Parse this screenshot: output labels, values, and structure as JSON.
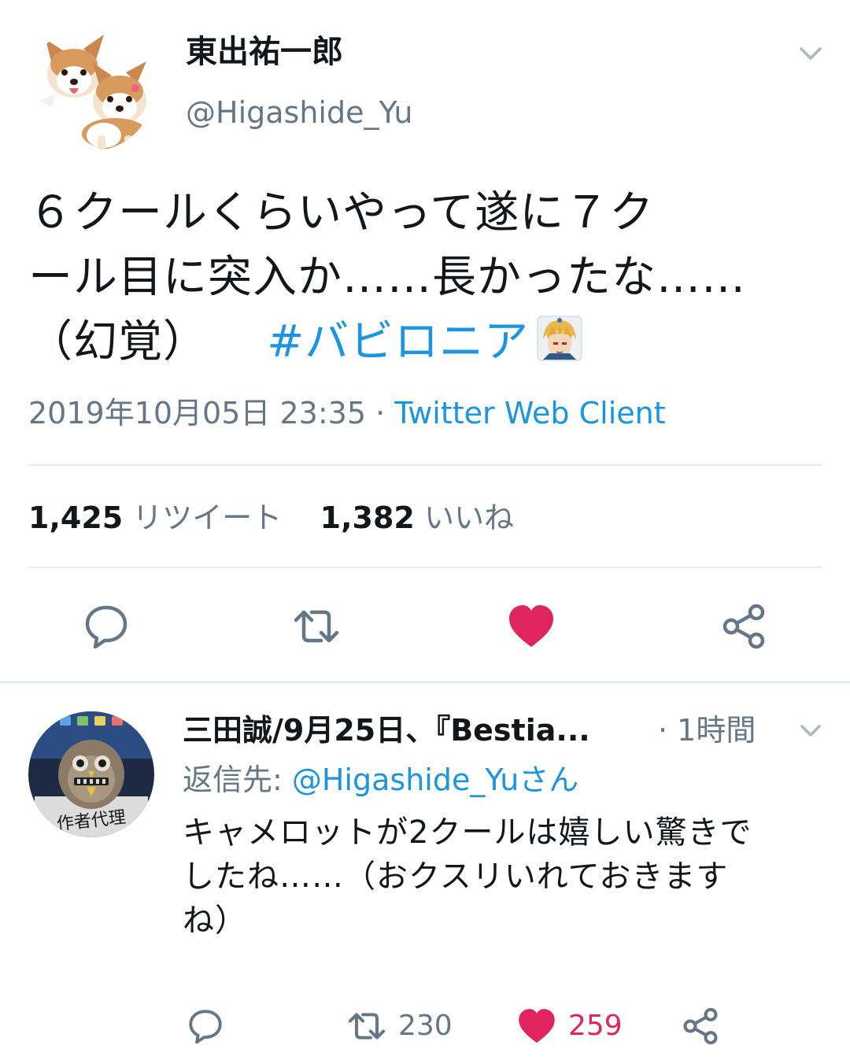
{
  "tweet": {
    "display_name": "東出祐一郎",
    "handle": "@Higashide_Yu",
    "body_lines": [
      "６クールくらいやって遂に７ク",
      "ール目に突入か……長かったな……",
      "（幻覚）"
    ],
    "hashtag": "#バビロニア",
    "datetime": "2019年10月05日 23:35 ·",
    "client": "Twitter Web Client",
    "retweet_count": "1,425",
    "retweet_label": "リツイート",
    "like_count": "1,382",
    "like_label": "いいね"
  },
  "reply": {
    "display_name": "三田誠/9月25日、『Bestia...",
    "time": "· 1時間",
    "reply_prefix": "返信先: ",
    "reply_mention": "@Higashide_Yuさん",
    "body_lines": [
      "キャメロットが2クールは嬉しい驚きで",
      "したね……（おクスリいれておきます",
      "ね）"
    ],
    "avatar_caption": "作者代理",
    "retweet_count": "230",
    "like_count": "259"
  },
  "colors": {
    "accent": "#1b95e0",
    "secondary_text": "#657786",
    "like": "#e0245e",
    "divider": "#e6ecf0"
  },
  "icons": {
    "reply": "reply-icon",
    "retweet": "retweet-icon",
    "like": "heart-icon",
    "share": "share-icon",
    "menu": "chevron-down-icon"
  }
}
